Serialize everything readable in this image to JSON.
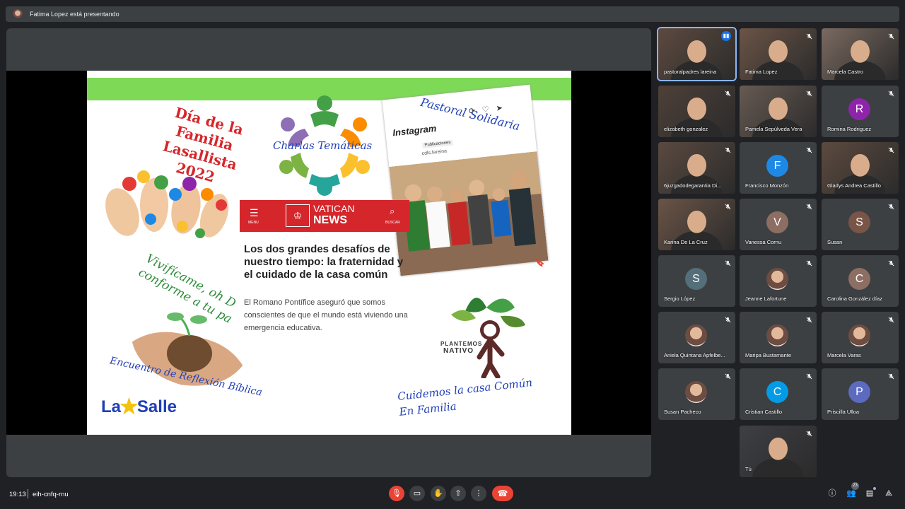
{
  "banner": {
    "presenter_text": "Fatima Lopez está presentando"
  },
  "slide": {
    "dia_text": "Día de la Familia Lasallista 2022",
    "charlas": "Charlas Temáticas",
    "pastoral": "Pastoral Solidaria",
    "vivificame": "Vivifícame, oh D\nconforme a tu pa",
    "encuentro": "Encuentro de Reflexión Bíblica",
    "cuidemos": "Cuidemos la casa Común\nEn Familia",
    "lasalle_a": "La",
    "lasalle_b": "Salle",
    "vatican_name": "VATICAN",
    "vatican_news": "NEWS",
    "vatican_menu": "MENU",
    "vatican_search": "BUSCAR",
    "headline": "Los dos grandes desafíos de nuestro tiempo: la fraternidad y el cuidado de la casa común",
    "snippet": "El Romano Pontífice aseguró que somos conscientes de que el mundo está viviendo una emergencia educativa.",
    "insta_head": "Instagram",
    "insta_handle": "cdls.lareina",
    "insta_pub": "Publicaciones",
    "planta_1": "PLANTEMOS",
    "planta_2": "NATIVO"
  },
  "participants": [
    {
      "name": "pastoralpadres lareina",
      "type": "video",
      "speaking": true
    },
    {
      "name": "Fatima Lopez",
      "type": "video"
    },
    {
      "name": "Marcela Castro",
      "type": "video"
    },
    {
      "name": "elizabeth gonzalez",
      "type": "video"
    },
    {
      "name": "Pamela Sepúlveda Vera",
      "type": "video"
    },
    {
      "name": "Romina Rodriguez",
      "type": "avatar",
      "initial": "R",
      "color": "#8e24aa"
    },
    {
      "name": "6juzgadodegarantia Di...",
      "type": "video"
    },
    {
      "name": "Francisco Monzón",
      "type": "avatar",
      "initial": "F",
      "color": "#1e88e5"
    },
    {
      "name": "Gladys Andrea Castillo",
      "type": "video"
    },
    {
      "name": "Karina De La Cruz",
      "type": "video"
    },
    {
      "name": "Vanessa Cornu",
      "type": "avatar",
      "initial": "V",
      "color": "#8d6e63"
    },
    {
      "name": "Susan",
      "type": "avatar",
      "initial": "S",
      "color": "#795548"
    },
    {
      "name": "Sergio López",
      "type": "avatar",
      "initial": "S",
      "color": "#546e7a"
    },
    {
      "name": "Jeanne Lafortune",
      "type": "photo"
    },
    {
      "name": "Carolina González díaz",
      "type": "avatar",
      "initial": "C",
      "color": "#8d6e63"
    },
    {
      "name": "Aniela Quintana Apfelbe...",
      "type": "photo"
    },
    {
      "name": "Maripa Bustamante",
      "type": "photo"
    },
    {
      "name": "Marcela Varas",
      "type": "photo"
    },
    {
      "name": "Susan Pacheco",
      "type": "photo"
    },
    {
      "name": "Cristian Castillo",
      "type": "avatar",
      "initial": "C",
      "color": "#039be5"
    },
    {
      "name": "Priscilla Ulloa",
      "type": "avatar",
      "initial": "P",
      "color": "#5c6bc0"
    },
    {
      "name": "Tú",
      "type": "video"
    }
  ],
  "bottom_bar": {
    "time": "19:13",
    "meeting_code": "eih-cnfq-rnu",
    "participant_count": "23",
    "icons": [
      "mic-off-icon",
      "camera-icon",
      "raise-hand-icon",
      "present-icon",
      "more-icon",
      "leave-call-icon",
      "info-icon",
      "people-icon",
      "chat-icon",
      "activities-icon"
    ]
  }
}
